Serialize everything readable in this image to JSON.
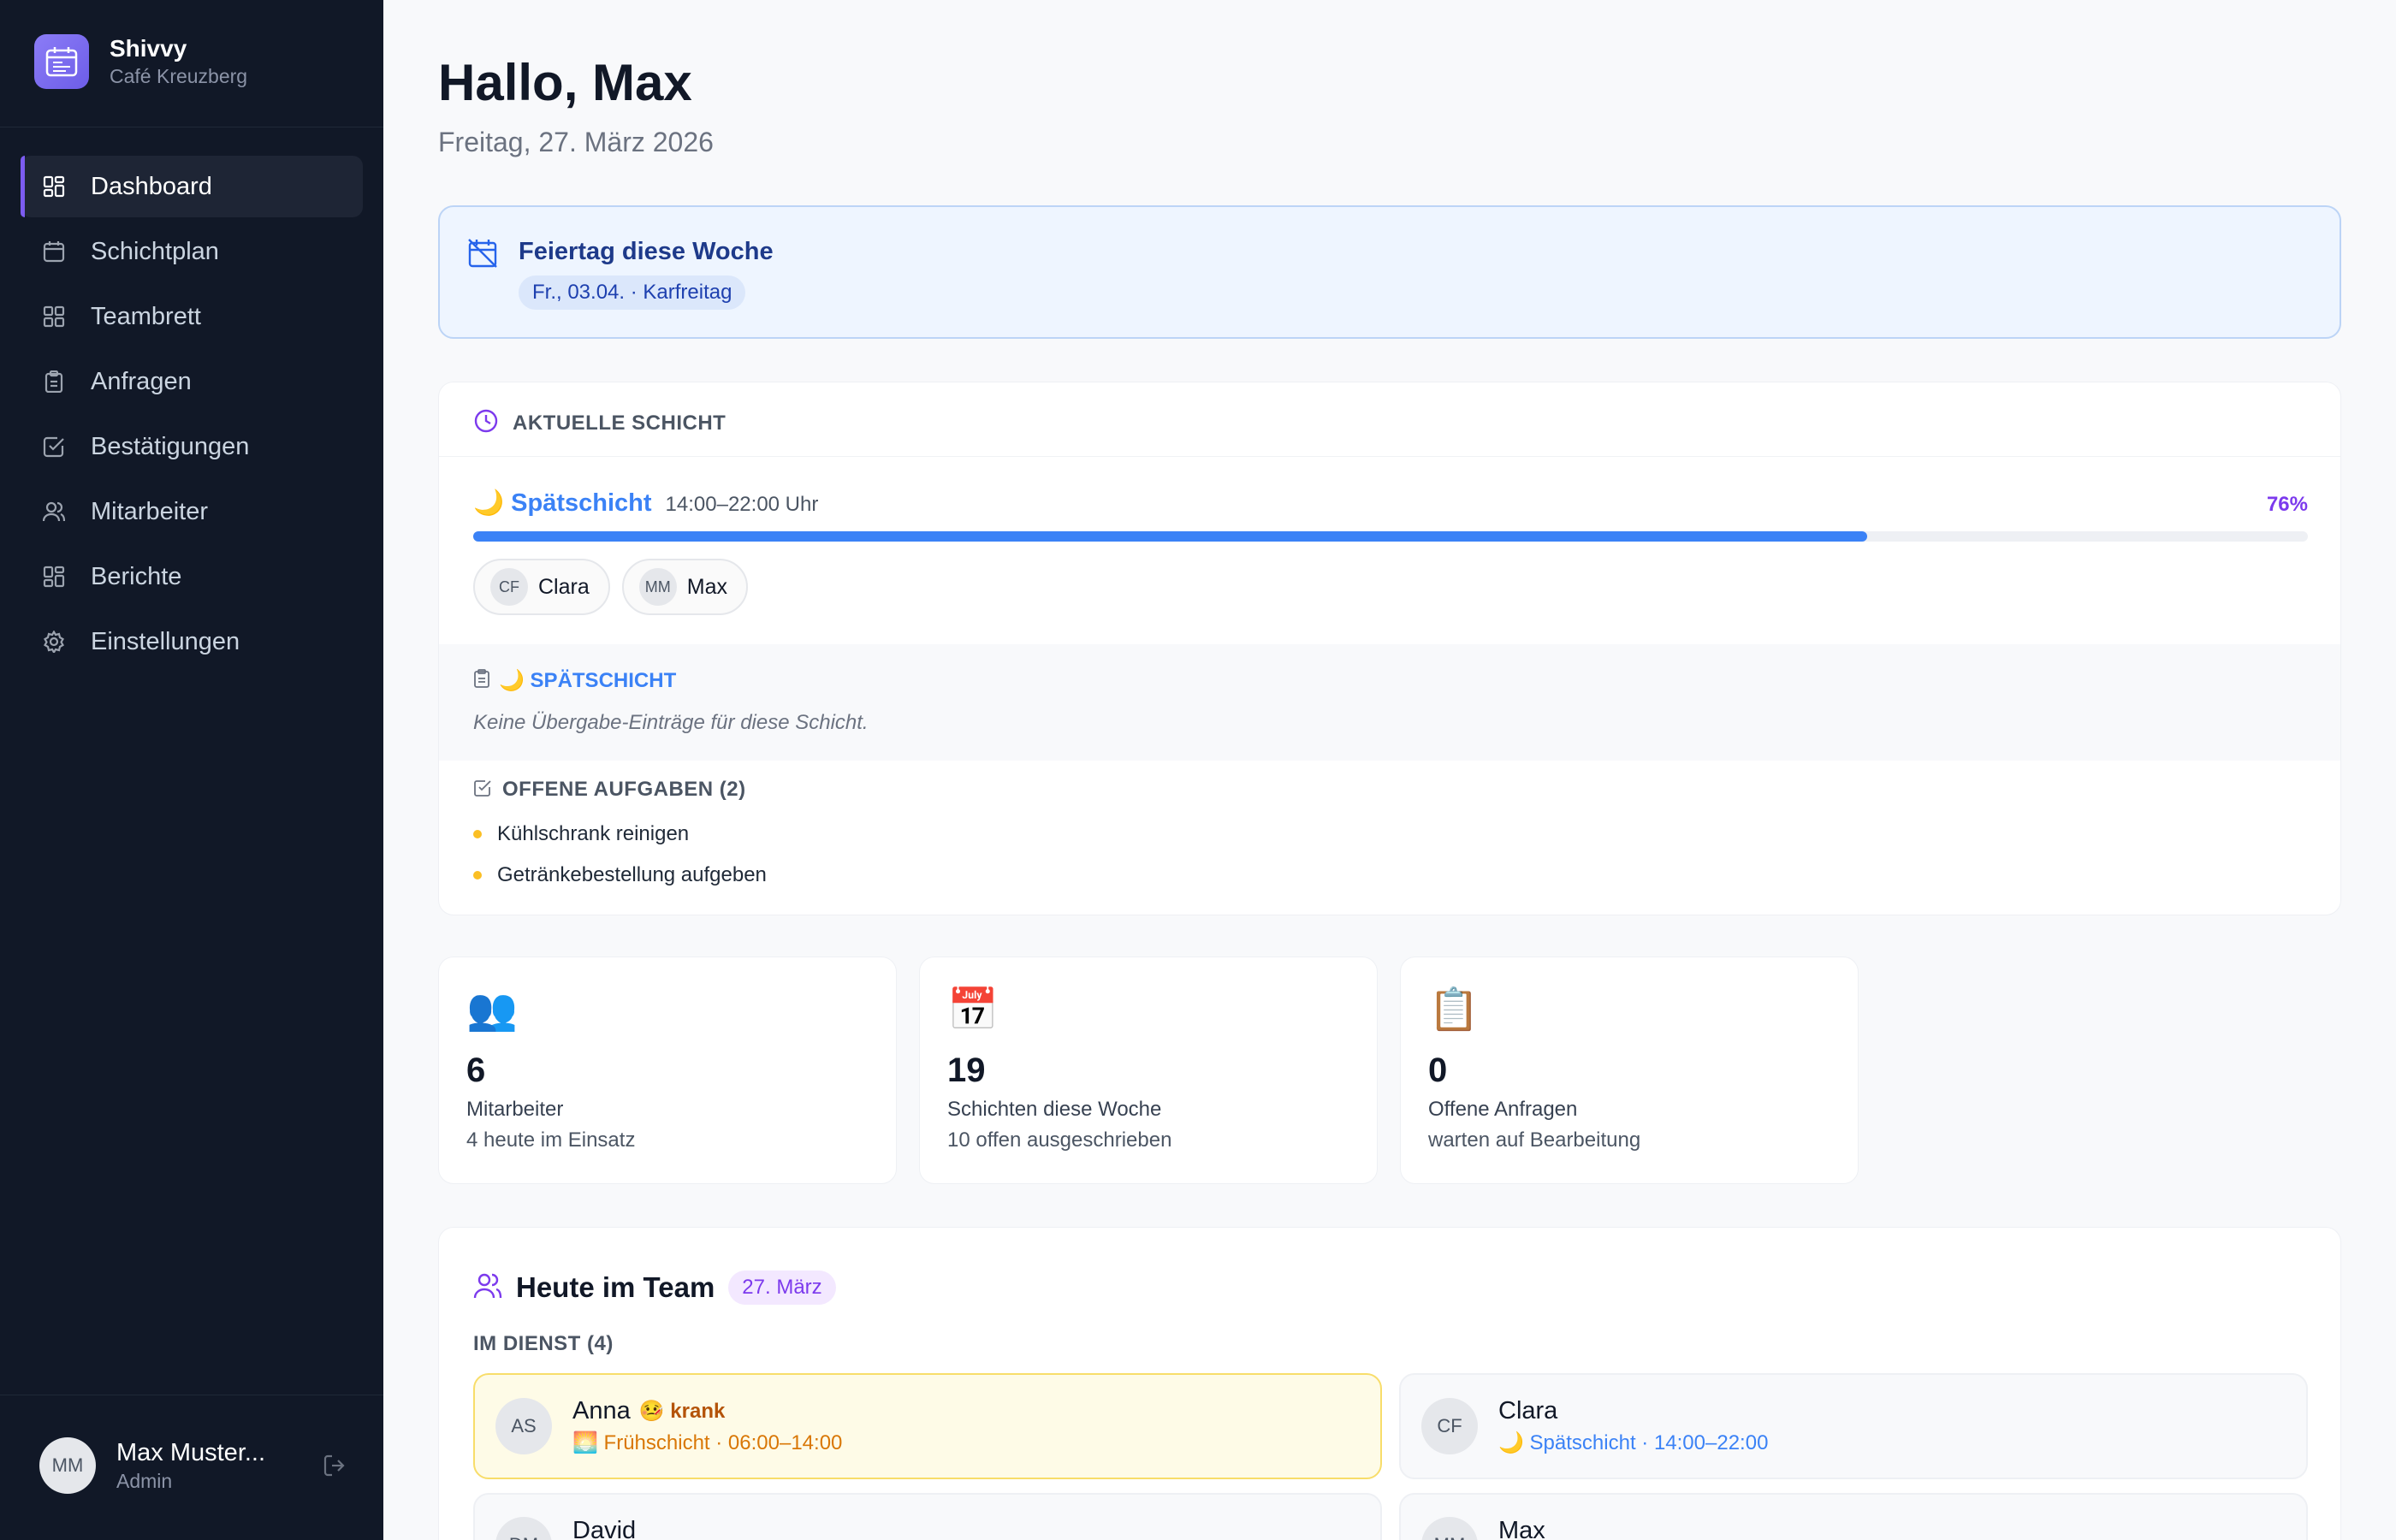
{
  "brand": {
    "name": "Shivvy",
    "subtitle": "Café Kreuzberg",
    "logo_icon": "calendar-logo-icon",
    "accent": "#7c5cf0"
  },
  "nav": {
    "items": [
      {
        "label": "Dashboard",
        "icon": "grid-icon",
        "active": true
      },
      {
        "label": "Schichtplan",
        "icon": "calendar-icon"
      },
      {
        "label": "Teambrett",
        "icon": "grid-icon"
      },
      {
        "label": "Anfragen",
        "icon": "clipboard-icon"
      },
      {
        "label": "Bestätigungen",
        "icon": "check-square-icon"
      },
      {
        "label": "Mitarbeiter",
        "icon": "users-icon"
      },
      {
        "label": "Berichte",
        "icon": "grid-icon"
      },
      {
        "label": "Einstellungen",
        "icon": "gear-icon"
      }
    ]
  },
  "user": {
    "initials": "MM",
    "name": "Max Muster...",
    "role": "Admin",
    "logout_icon": "logout-icon"
  },
  "header": {
    "greeting": "Hallo, Max",
    "date": "Freitag, 27. März 2026"
  },
  "holiday": {
    "title": "Feiertag diese Woche",
    "badge": "Fr., 03.04. · Karfreitag",
    "icon": "calendar-off-icon",
    "color": "#1e3a8a"
  },
  "current_shift": {
    "section_label": "AKTUELLE SCHICHT",
    "name": "🌙 Spätschicht",
    "time": "14:00–22:00 Uhr",
    "progress_label": "76%",
    "progress": 0.76,
    "staff": [
      {
        "initials": "CF",
        "name": "Clara"
      },
      {
        "initials": "MM",
        "name": "Max"
      }
    ],
    "handover": {
      "title": "🌙 SPÄTSCHICHT",
      "note": "Keine Übergabe-Einträge für diese Schicht."
    },
    "tasks": {
      "label": "OFFENE AUFGABEN (2)",
      "items": [
        "Kühlschrank reinigen",
        "Getränkebestellung aufgeben"
      ]
    }
  },
  "stats": [
    {
      "emoji": "👥",
      "number": "6",
      "label": "Mitarbeiter",
      "sub": "4 heute im Einsatz"
    },
    {
      "emoji": "📅",
      "number": "19",
      "label": "Schichten diese Woche",
      "sub": "10 offen ausgeschrieben"
    },
    {
      "emoji": "📋",
      "number": "0",
      "label": "Offene Anfragen",
      "sub": "warten auf Bearbeitung"
    }
  ],
  "team": {
    "title": "Heute im Team",
    "date": "27. März",
    "on_duty_label": "IM DIENST (4)",
    "members": [
      {
        "initials": "AS",
        "name": "Anna",
        "status": "🤒 krank",
        "shift": "🌅 Frühschicht · 06:00–14:00"
      },
      {
        "initials": "CF",
        "name": "Clara",
        "status": "",
        "shift": "🌙 Spätschicht · 14:00–22:00"
      },
      {
        "initials": "DM",
        "name": "David",
        "status": "",
        "shift": ""
      },
      {
        "initials": "MM",
        "name": "Max",
        "status": "",
        "shift": ""
      }
    ]
  }
}
